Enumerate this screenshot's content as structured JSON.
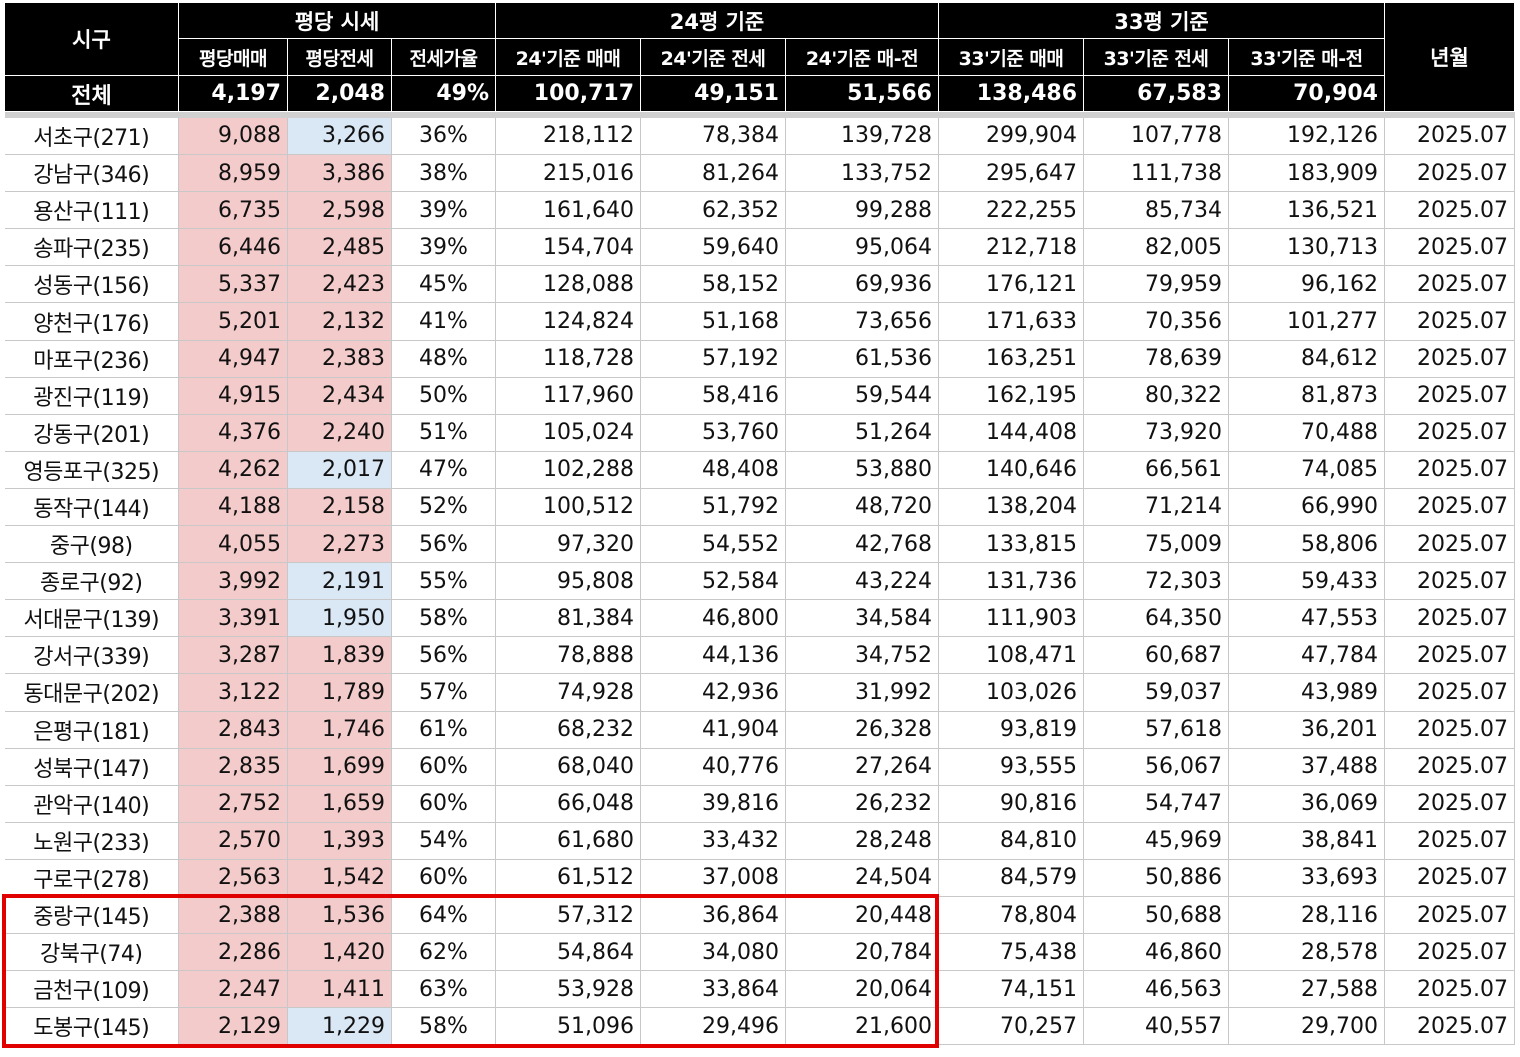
{
  "headers": {
    "district": "시구",
    "price_per_pyeong": "평당 시세",
    "basis24": "24평 기준",
    "basis33": "33평 기준",
    "yearmonth": "년월",
    "sub": [
      "평당매매",
      "평당전세",
      "전세가율",
      "24'기준 매매",
      "24'기준 전세",
      "24'기준 매-전",
      "33'기준 매매",
      "33'기준 전세",
      "33'기준 매-전"
    ]
  },
  "total": {
    "label": "전체",
    "values": [
      "4,197",
      "2,048",
      "49%",
      "100,717",
      "49,151",
      "51,566",
      "138,486",
      "67,583",
      "70,904"
    ],
    "yearmonth": ""
  },
  "rows": [
    {
      "district": "서초구(271)",
      "sale": "9,088",
      "jeonse": "3,266",
      "ratio": "36%",
      "s24": "218,112",
      "j24": "78,384",
      "d24": "139,728",
      "s33": "299,904",
      "j33": "107,778",
      "d33": "192,126",
      "ym": "2025.07",
      "jeonse_blue": true
    },
    {
      "district": "강남구(346)",
      "sale": "8,959",
      "jeonse": "3,386",
      "ratio": "38%",
      "s24": "215,016",
      "j24": "81,264",
      "d24": "133,752",
      "s33": "295,647",
      "j33": "111,738",
      "d33": "183,909",
      "ym": "2025.07",
      "jeonse_blue": false
    },
    {
      "district": "용산구(111)",
      "sale": "6,735",
      "jeonse": "2,598",
      "ratio": "39%",
      "s24": "161,640",
      "j24": "62,352",
      "d24": "99,288",
      "s33": "222,255",
      "j33": "85,734",
      "d33": "136,521",
      "ym": "2025.07",
      "jeonse_blue": false
    },
    {
      "district": "송파구(235)",
      "sale": "6,446",
      "jeonse": "2,485",
      "ratio": "39%",
      "s24": "154,704",
      "j24": "59,640",
      "d24": "95,064",
      "s33": "212,718",
      "j33": "82,005",
      "d33": "130,713",
      "ym": "2025.07",
      "jeonse_blue": false
    },
    {
      "district": "성동구(156)",
      "sale": "5,337",
      "jeonse": "2,423",
      "ratio": "45%",
      "s24": "128,088",
      "j24": "58,152",
      "d24": "69,936",
      "s33": "176,121",
      "j33": "79,959",
      "d33": "96,162",
      "ym": "2025.07",
      "jeonse_blue": false
    },
    {
      "district": "양천구(176)",
      "sale": "5,201",
      "jeonse": "2,132",
      "ratio": "41%",
      "s24": "124,824",
      "j24": "51,168",
      "d24": "73,656",
      "s33": "171,633",
      "j33": "70,356",
      "d33": "101,277",
      "ym": "2025.07",
      "jeonse_blue": false
    },
    {
      "district": "마포구(236)",
      "sale": "4,947",
      "jeonse": "2,383",
      "ratio": "48%",
      "s24": "118,728",
      "j24": "57,192",
      "d24": "61,536",
      "s33": "163,251",
      "j33": "78,639",
      "d33": "84,612",
      "ym": "2025.07",
      "jeonse_blue": false
    },
    {
      "district": "광진구(119)",
      "sale": "4,915",
      "jeonse": "2,434",
      "ratio": "50%",
      "s24": "117,960",
      "j24": "58,416",
      "d24": "59,544",
      "s33": "162,195",
      "j33": "80,322",
      "d33": "81,873",
      "ym": "2025.07",
      "jeonse_blue": false
    },
    {
      "district": "강동구(201)",
      "sale": "4,376",
      "jeonse": "2,240",
      "ratio": "51%",
      "s24": "105,024",
      "j24": "53,760",
      "d24": "51,264",
      "s33": "144,408",
      "j33": "73,920",
      "d33": "70,488",
      "ym": "2025.07",
      "jeonse_blue": false
    },
    {
      "district": "영등포구(325)",
      "sale": "4,262",
      "jeonse": "2,017",
      "ratio": "47%",
      "s24": "102,288",
      "j24": "48,408",
      "d24": "53,880",
      "s33": "140,646",
      "j33": "66,561",
      "d33": "74,085",
      "ym": "2025.07",
      "jeonse_blue": true
    },
    {
      "district": "동작구(144)",
      "sale": "4,188",
      "jeonse": "2,158",
      "ratio": "52%",
      "s24": "100,512",
      "j24": "51,792",
      "d24": "48,720",
      "s33": "138,204",
      "j33": "71,214",
      "d33": "66,990",
      "ym": "2025.07",
      "jeonse_blue": false
    },
    {
      "district": "중구(98)",
      "sale": "4,055",
      "jeonse": "2,273",
      "ratio": "56%",
      "s24": "97,320",
      "j24": "54,552",
      "d24": "42,768",
      "s33": "133,815",
      "j33": "75,009",
      "d33": "58,806",
      "ym": "2025.07",
      "jeonse_blue": false
    },
    {
      "district": "종로구(92)",
      "sale": "3,992",
      "jeonse": "2,191",
      "ratio": "55%",
      "s24": "95,808",
      "j24": "52,584",
      "d24": "43,224",
      "s33": "131,736",
      "j33": "72,303",
      "d33": "59,433",
      "ym": "2025.07",
      "jeonse_blue": true
    },
    {
      "district": "서대문구(139)",
      "sale": "3,391",
      "jeonse": "1,950",
      "ratio": "58%",
      "s24": "81,384",
      "j24": "46,800",
      "d24": "34,584",
      "s33": "111,903",
      "j33": "64,350",
      "d33": "47,553",
      "ym": "2025.07",
      "jeonse_blue": true
    },
    {
      "district": "강서구(339)",
      "sale": "3,287",
      "jeonse": "1,839",
      "ratio": "56%",
      "s24": "78,888",
      "j24": "44,136",
      "d24": "34,752",
      "s33": "108,471",
      "j33": "60,687",
      "d33": "47,784",
      "ym": "2025.07",
      "jeonse_blue": false
    },
    {
      "district": "동대문구(202)",
      "sale": "3,122",
      "jeonse": "1,789",
      "ratio": "57%",
      "s24": "74,928",
      "j24": "42,936",
      "d24": "31,992",
      "s33": "103,026",
      "j33": "59,037",
      "d33": "43,989",
      "ym": "2025.07",
      "jeonse_blue": false
    },
    {
      "district": "은평구(181)",
      "sale": "2,843",
      "jeonse": "1,746",
      "ratio": "61%",
      "s24": "68,232",
      "j24": "41,904",
      "d24": "26,328",
      "s33": "93,819",
      "j33": "57,618",
      "d33": "36,201",
      "ym": "2025.07",
      "jeonse_blue": false
    },
    {
      "district": "성북구(147)",
      "sale": "2,835",
      "jeonse": "1,699",
      "ratio": "60%",
      "s24": "68,040",
      "j24": "40,776",
      "d24": "27,264",
      "s33": "93,555",
      "j33": "56,067",
      "d33": "37,488",
      "ym": "2025.07",
      "jeonse_blue": false
    },
    {
      "district": "관악구(140)",
      "sale": "2,752",
      "jeonse": "1,659",
      "ratio": "60%",
      "s24": "66,048",
      "j24": "39,816",
      "d24": "26,232",
      "s33": "90,816",
      "j33": "54,747",
      "d33": "36,069",
      "ym": "2025.07",
      "jeonse_blue": false
    },
    {
      "district": "노원구(233)",
      "sale": "2,570",
      "jeonse": "1,393",
      "ratio": "54%",
      "s24": "61,680",
      "j24": "33,432",
      "d24": "28,248",
      "s33": "84,810",
      "j33": "45,969",
      "d33": "38,841",
      "ym": "2025.07",
      "jeonse_blue": false
    },
    {
      "district": "구로구(278)",
      "sale": "2,563",
      "jeonse": "1,542",
      "ratio": "60%",
      "s24": "61,512",
      "j24": "37,008",
      "d24": "24,504",
      "s33": "84,579",
      "j33": "50,886",
      "d33": "33,693",
      "ym": "2025.07",
      "jeonse_blue": false
    },
    {
      "district": "중랑구(145)",
      "sale": "2,388",
      "jeonse": "1,536",
      "ratio": "64%",
      "s24": "57,312",
      "j24": "36,864",
      "d24": "20,448",
      "s33": "78,804",
      "j33": "50,688",
      "d33": "28,116",
      "ym": "2025.07",
      "jeonse_blue": false
    },
    {
      "district": "강북구(74)",
      "sale": "2,286",
      "jeonse": "1,420",
      "ratio": "62%",
      "s24": "54,864",
      "j24": "34,080",
      "d24": "20,784",
      "s33": "75,438",
      "j33": "46,860",
      "d33": "28,578",
      "ym": "2025.07",
      "jeonse_blue": false
    },
    {
      "district": "금천구(109)",
      "sale": "2,247",
      "jeonse": "1,411",
      "ratio": "63%",
      "s24": "53,928",
      "j24": "33,864",
      "d24": "20,064",
      "s33": "74,151",
      "j33": "46,563",
      "d33": "27,588",
      "ym": "2025.07",
      "jeonse_blue": false
    },
    {
      "district": "도봉구(145)",
      "sale": "2,129",
      "jeonse": "1,229",
      "ratio": "58%",
      "s24": "51,096",
      "j24": "29,496",
      "d24": "21,600",
      "s33": "70,257",
      "j33": "40,557",
      "d33": "29,700",
      "ym": "2025.07",
      "jeonse_blue": true
    }
  ],
  "highlight_color": "#e00000"
}
